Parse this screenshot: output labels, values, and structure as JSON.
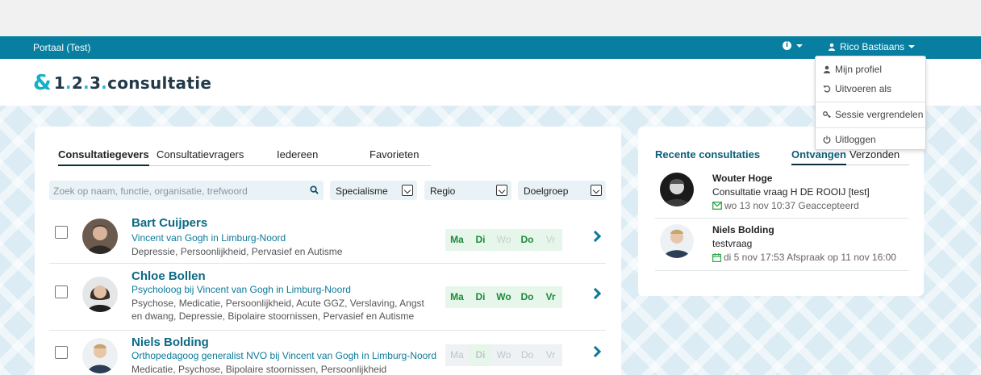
{
  "navbar": {
    "brand": "Portaal (Test)",
    "user_name": "Rico Bastiaans"
  },
  "logo": {
    "part1": "1",
    "dot1": ".",
    "part2": "2",
    "dot2": ".",
    "part3": "3",
    "dot3": ".",
    "part4": "consultatie"
  },
  "user_menu": {
    "items": [
      {
        "label": "Mijn profiel",
        "icon": "user-icon"
      },
      {
        "label": "Uitvoeren als",
        "icon": "undo-icon"
      },
      {
        "label": "Sessie vergrendelen",
        "icon": "key-icon"
      },
      {
        "label": "Uitloggen",
        "icon": "power-icon"
      }
    ]
  },
  "main": {
    "tabs": [
      "Consultatiegevers",
      "Consultatievragers",
      "Iedereen",
      "Favorieten"
    ],
    "active_tab": "Consultatiegevers",
    "search_placeholder": "Zoek op naam, functie, organisatie, trefwoord",
    "filters": [
      "Specialisme",
      "Regio",
      "Doelgroep"
    ],
    "day_labels": [
      "Ma",
      "Di",
      "Wo",
      "Do",
      "Vr"
    ],
    "people": [
      {
        "name": "Bart Cuijpers",
        "org": "Vincent van Gogh in Limburg-Noord",
        "tags": "Depressie, Persoonlijkheid, Pervasief en Autisme",
        "days": [
          true,
          true,
          false,
          true,
          false
        ]
      },
      {
        "name": "Chloe Bollen",
        "org": "Psycholoog bij Vincent van Gogh in Limburg-Noord",
        "tags": "Psychose, Medicatie, Persoonlijkheid, Acute GGZ, Verslaving, Angst en dwang, Depressie, Bipolaire stoornissen, Pervasief en Autisme",
        "days": [
          true,
          true,
          true,
          true,
          true
        ]
      },
      {
        "name": "Niels Bolding",
        "org": "Orthopedagoog generalist NVO bij Vincent van Gogh in Limburg-Noord",
        "tags": "Medicatie, Psychose, Bipolaire stoornissen, Persoonlijkheid",
        "days": [
          false,
          true,
          false,
          false,
          false
        ]
      }
    ]
  },
  "recent": {
    "title": "Recente consultaties",
    "tabs": [
      "Ontvangen",
      "Verzonden"
    ],
    "active_tab": "Ontvangen",
    "items": [
      {
        "who": "Wouter Hoge",
        "subject": "Consultatie vraag H DE ROOIJ [test]",
        "meta": "wo 13 nov 10:37 Geaccepteerd",
        "icon": "envelope-icon"
      },
      {
        "who": "Niels Bolding",
        "subject": "testvraag",
        "meta": "di 5 nov 17:53 Afspraak op 11 nov 16:00",
        "icon": "calendar-icon"
      }
    ]
  },
  "colors": {
    "navbar": "#087ea0",
    "accent": "#0b7a9a",
    "available": "#1e8a3a",
    "available_bg": "#e7f6ea"
  }
}
